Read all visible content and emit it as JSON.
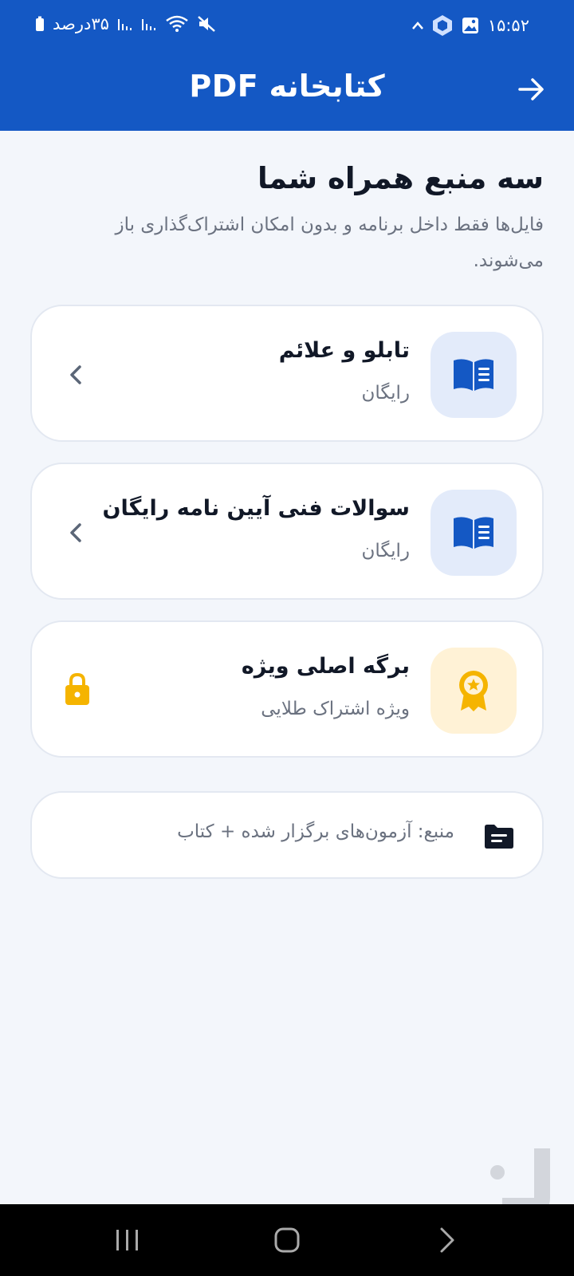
{
  "status_bar": {
    "time": "۱۵:۵۲",
    "battery_text": "۳۵درصد",
    "icons": [
      "chevron-up-icon",
      "hex-app-icon",
      "gallery-icon",
      "signal-icon",
      "signal-icon",
      "wifi-icon",
      "mute-icon",
      "battery-icon"
    ]
  },
  "app_bar": {
    "title": "کتابخانه PDF",
    "back_icon": "arrow-right-icon"
  },
  "intro": {
    "heading": "سه منبع همراه شما",
    "subtitle": "فایل‌ها فقط داخل برنامه و بدون امکان اشتراک‌گذاری باز می‌شوند."
  },
  "resources": [
    {
      "title": "تابلو و علائم",
      "subtitle": "رایگان",
      "icon": "open-book-icon",
      "action_icon": "chevron-left-icon",
      "locked": false
    },
    {
      "title": "سوالات فنی آیین نامه رایگان",
      "subtitle": "رایگان",
      "icon": "open-book-icon",
      "action_icon": "chevron-left-icon",
      "locked": false
    },
    {
      "title": "برگه اصلی ویژه",
      "subtitle": "ویژه اشتراک طلایی",
      "icon": "award-badge-icon",
      "action_icon": "lock-icon",
      "locked": true
    }
  ],
  "source_note": {
    "text": "منبع: آزمون‌های برگزار شده + کتاب",
    "icon": "folder-icon"
  },
  "colors": {
    "primary": "#1458c4",
    "background": "#f3f6fb",
    "text_dark": "#111827",
    "text_muted": "#6b7280",
    "icon_bg_blue": "#e3ebfa",
    "icon_bg_gold": "#fff2d6",
    "gold": "#f5b400"
  },
  "nav_bar": {
    "buttons": [
      "recents-icon",
      "home-icon",
      "back-nav-icon"
    ]
  }
}
